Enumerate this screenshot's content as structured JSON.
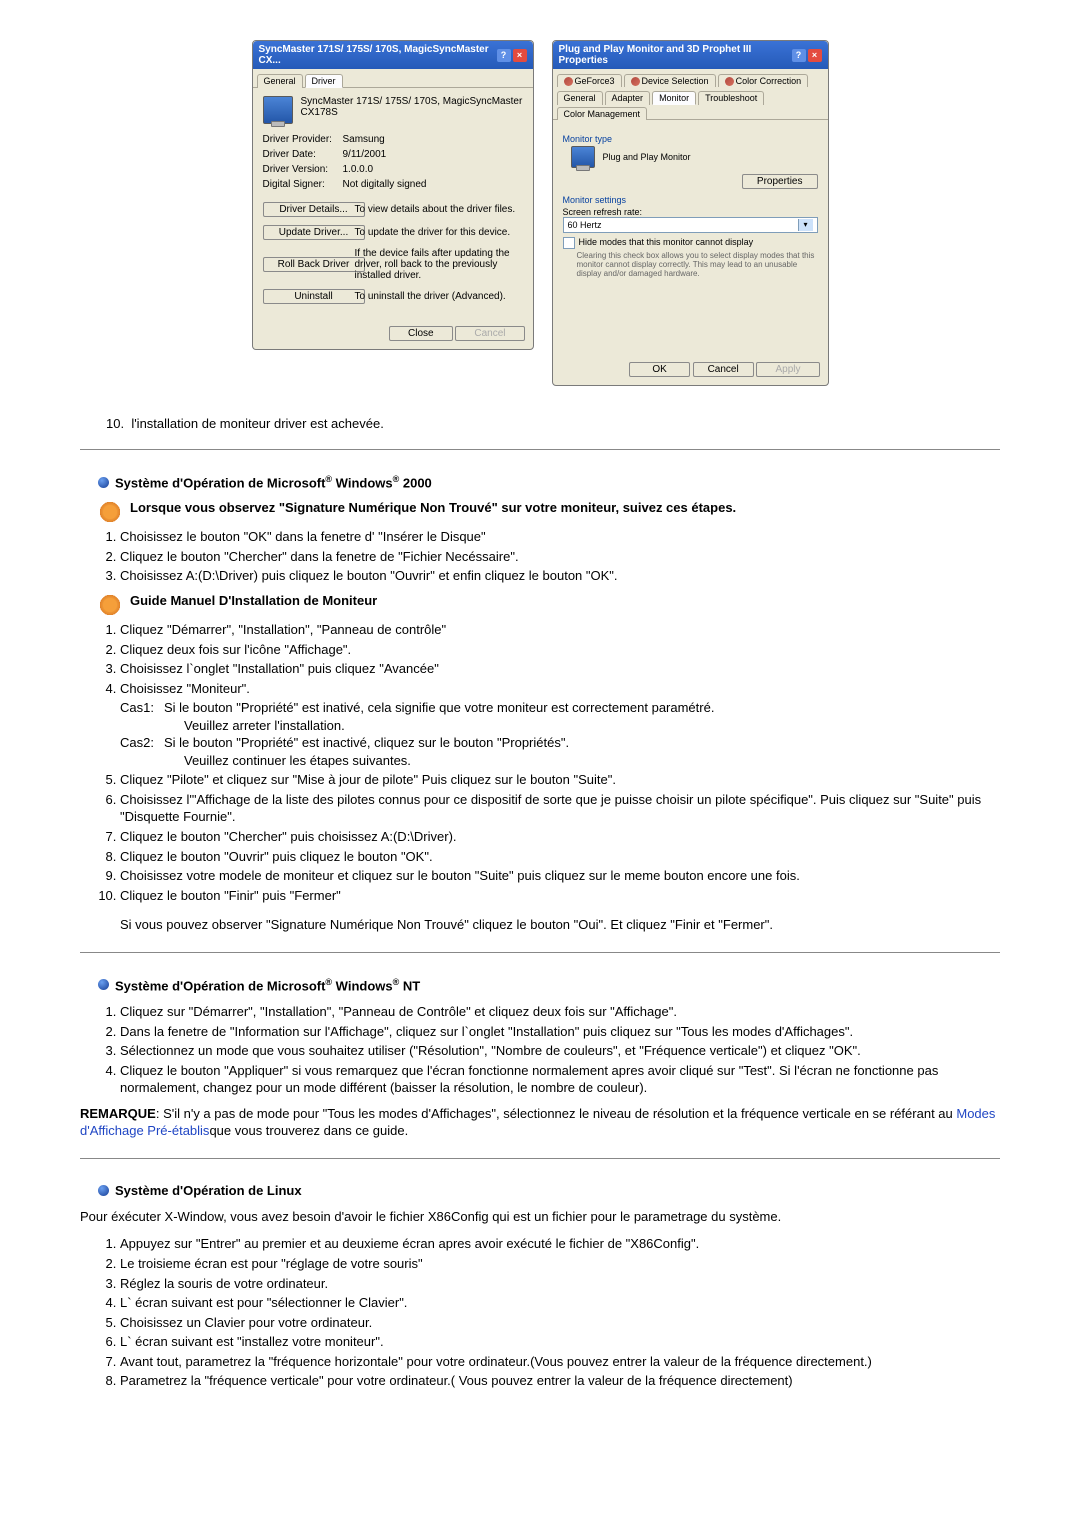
{
  "dialog1": {
    "title": "SyncMaster 171S/ 175S/ 170S, MagicSyncMaster CX...",
    "tabs": {
      "general": "General",
      "driver": "Driver"
    },
    "product": "SyncMaster 171S/ 175S/ 170S, MagicSyncMaster CX178S",
    "labels": {
      "provider": "Driver Provider:",
      "provider_v": "Samsung",
      "date": "Driver Date:",
      "date_v": "9/11/2001",
      "version": "Driver Version:",
      "version_v": "1.0.0.0",
      "signer": "Digital Signer:",
      "signer_v": "Not digitally signed"
    },
    "buttons": {
      "details": "Driver Details...",
      "details_txt": "To view details about the driver files.",
      "update": "Update Driver...",
      "update_txt": "To update the driver for this device.",
      "rollback": "Roll Back Driver",
      "rollback_txt": "If the device fails after updating the driver, roll back to the previously installed driver.",
      "uninstall": "Uninstall",
      "uninstall_txt": "To uninstall the driver (Advanced).",
      "close": "Close",
      "cancel": "Cancel"
    }
  },
  "dialog2": {
    "title": "Plug and Play Monitor and 3D Prophet III Properties",
    "tabs_top": {
      "gf": "GeForce3",
      "dev": "Device Selection",
      "cc": "Color Correction"
    },
    "tabs_bot": {
      "general": "General",
      "adapter": "Adapter",
      "monitor": "Monitor",
      "trouble": "Troubleshoot",
      "cm": "Color Management"
    },
    "mtype_label": "Monitor type",
    "mtype_value": "Plug and Play Monitor",
    "properties": "Properties",
    "msettings": "Monitor settings",
    "refresh_label": "Screen refresh rate:",
    "refresh_value": "60 Hertz",
    "hide_chk": "Hide modes that this monitor cannot display",
    "hide_note": "Clearing this check box allows you to select display modes that this monitor cannot display correctly. This may lead to an unusable display and/or damaged hardware.",
    "ok": "OK",
    "cancel": "Cancel",
    "apply": "Apply"
  },
  "step_final": "l'installation de moniteur driver est achevée.",
  "step_final_num": "10.",
  "win2000": {
    "title_a": "Système d'Opération de Microsoft",
    "title_b": " Windows",
    "title_c": " 2000",
    "sig": "Lorsque vous observez \"Signature Numérique Non Trouvé\" sur votre moniteur, suivez ces étapes.",
    "s1": "Choisissez le bouton \"OK\" dans la fenetre d' \"Insérer le Disque\"",
    "s2": "Cliquez le bouton \"Chercher\" dans la fenetre de \"Fichier Necéssaire\".",
    "s3": "Choisissez A:(D:\\Driver) puis cliquez le bouton \"Ouvrir\" et enfin cliquez le bouton \"OK\".",
    "guide": "Guide Manuel D'Installation de Moniteur",
    "g1": "Cliquez \"Démarrer\", \"Installation\", \"Panneau de contrôle\"",
    "g2": "Cliquez deux fois sur l'icône \"Affichage\".",
    "g3": "Choisissez l`onglet \"Installation\" puis cliquez \"Avancée\"",
    "g4": "Choisissez \"Moniteur\".",
    "c1a": "Cas1:",
    "c1b": "Si le bouton \"Propriété\" est inativé, cela signifie que votre moniteur est correctement paramétré.",
    "c1c": "Veuillez arreter l'installation.",
    "c2a": "Cas2:",
    "c2b": "Si le bouton \"Propriété\" est inactivé, cliquez sur le bouton \"Propriétés\".",
    "c2c": "Veuillez continuer les étapes suivantes.",
    "g5": "Cliquez \"Pilote\" et cliquez sur \"Mise à jour de pilote\" Puis cliquez sur le bouton \"Suite\".",
    "g6": "Choisissez l'\"Affichage de la liste des pilotes connus pour ce dispositif de sorte que je puisse choisir un pilote spécifique\". Puis cliquez sur \"Suite\" puis \"Disquette Fournie\".",
    "g7": "Cliquez le bouton \"Chercher\" puis choisissez A:(D:\\Driver).",
    "g8": "Cliquez le bouton \"Ouvrir\" puis cliquez le bouton \"OK\".",
    "g9": "Choisissez votre modele de moniteur et cliquez sur le bouton \"Suite\" puis cliquez sur le meme bouton encore une fois.",
    "g10": "Cliquez le bouton \"Finir\" puis \"Fermer\"",
    "gend": "Si vous pouvez observer \"Signature Numérique Non Trouvé\" cliquez le bouton \"Oui\". Et cliquez \"Finir et \"Fermer\"."
  },
  "winnt": {
    "title_a": "Système d'Opération de Microsoft",
    "title_b": " Windows",
    "title_c": " NT",
    "s1": "Cliquez sur \"Démarrer\", \"Installation\", \"Panneau de Contrôle\" et cliquez deux fois sur \"Affichage\".",
    "s2": "Dans la fenetre de \"Information sur l'Affichage\", cliquez sur l`onglet \"Installation\" puis cliquez sur \"Tous les modes d'Affichages\".",
    "s3": "Sélectionnez un mode que vous souhaitez utiliser (\"Résolution\", \"Nombre de couleurs\", et \"Fréquence verticale\") et cliquez \"OK\".",
    "s4": "Cliquez le bouton \"Appliquer\" si vous remarquez que l'écran fonctionne normalement apres avoir cliqué sur \"Test\". Si l'écran ne fonctionne pas normalement, changez pour un mode différent (baisser la résolution, le nombre de couleur).",
    "note_lbl": "REMARQUE",
    "note_a": ": S'il n'y a pas de mode pour \"Tous les modes d'Affichages\", sélectionnez le niveau de résolution et la fréquence verticale en se référant au ",
    "note_link": "Modes d'Affichage Pré-établis",
    "note_b": "que vous trouverez dans ce guide."
  },
  "linux": {
    "title": "Système d'Opération de Linux",
    "intro": "Pour éxécuter X-Window, vous avez besoin d'avoir le fichier X86Config qui est un fichier pour le parametrage du système.",
    "s1": "Appuyez sur \"Entrer\" au premier et au deuxieme écran apres avoir exécuté le fichier de \"X86Config\".",
    "s2": "Le troisieme écran est pour \"réglage de votre souris\"",
    "s3": "Réglez la souris de votre ordinateur.",
    "s4": "L` écran suivant est pour \"sélectionner le Clavier\".",
    "s5": "Choisissez un Clavier pour votre ordinateur.",
    "s6": "L` écran suivant est \"installez votre moniteur\".",
    "s7": "Avant tout, parametrez la \"fréquence horizontale\" pour votre ordinateur.(Vous pouvez entrer la valeur de la fréquence directement.)",
    "s8": "Parametrez la \"fréquence verticale\" pour votre ordinateur.( Vous pouvez entrer la valeur de la fréquence directement)"
  }
}
